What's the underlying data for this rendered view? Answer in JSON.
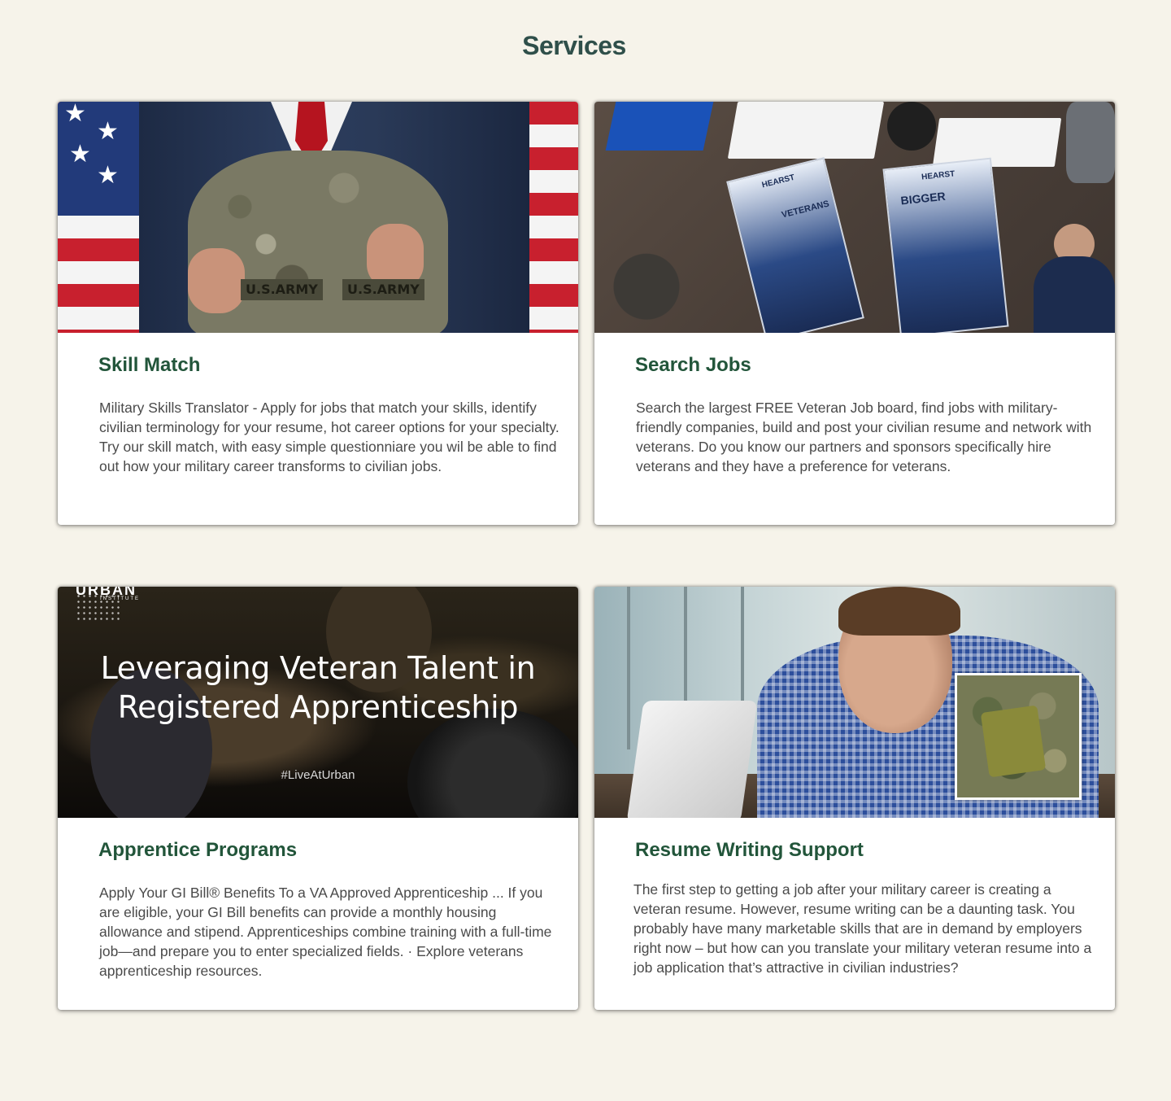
{
  "page": {
    "title": "Services"
  },
  "cards": [
    {
      "title": "Skill Match",
      "text": "Military Skills Translator - Apply for jobs that match your skills, identify civilian terminology for your resume, hot career options for your specialty. Try our skill match, with easy simple questionniare you wil be able to find out  how your military career transforms to civilian jobs.",
      "image": {
        "tape_left": "U.S.ARMY",
        "tape_right": "U.S.ARMY"
      }
    },
    {
      "title": "Search Jobs",
      "text": "Search the largest FREE Veteran Job board, find jobs with military-friendly companies, build and post your civilian resume and network with veterans. Do you know our partners and sponsors specifically hire veterans and they have a preference for veterans.",
      "image": {
        "banner_left_brand": "HEARST",
        "banner_left_word": "VETERANS",
        "banner_right_brand": "HEARST",
        "banner_right_word": "BIGGER"
      }
    },
    {
      "title": "Apprentice Programs",
      "text": "Apply Your GI Bill® Benefits To a VA Approved Apprenticeship ... If you are eligible, your GI Bill benefits can provide a monthly housing allowance and stipend. Apprenticeships combine training with a full-time job—and prepare you to enter specialized fields. · Explore veterans apprenticeship resources.",
      "image": {
        "overlay_title": "Leveraging Veteran Talent in Registered Apprenticeship",
        "hashtag": "#LiveAtUrban",
        "logo_main": "URBAN",
        "logo_sub": "INSTITUTE"
      }
    },
    {
      "title": "Resume Writing Support",
      "text": "The first step to getting a job after your military career is creating a veteran resume. However, resume writing can be a daunting task. You probably have many marketable skills that are in demand by employers right now – but how can you translate your military veteran resume into a job application that’s attractive in civilian industries?"
    }
  ],
  "colors": {
    "background": "#f6f3ea",
    "page_title": "#2f4f4a",
    "card_title": "#22553a",
    "card_text": "#4a4a4a"
  }
}
